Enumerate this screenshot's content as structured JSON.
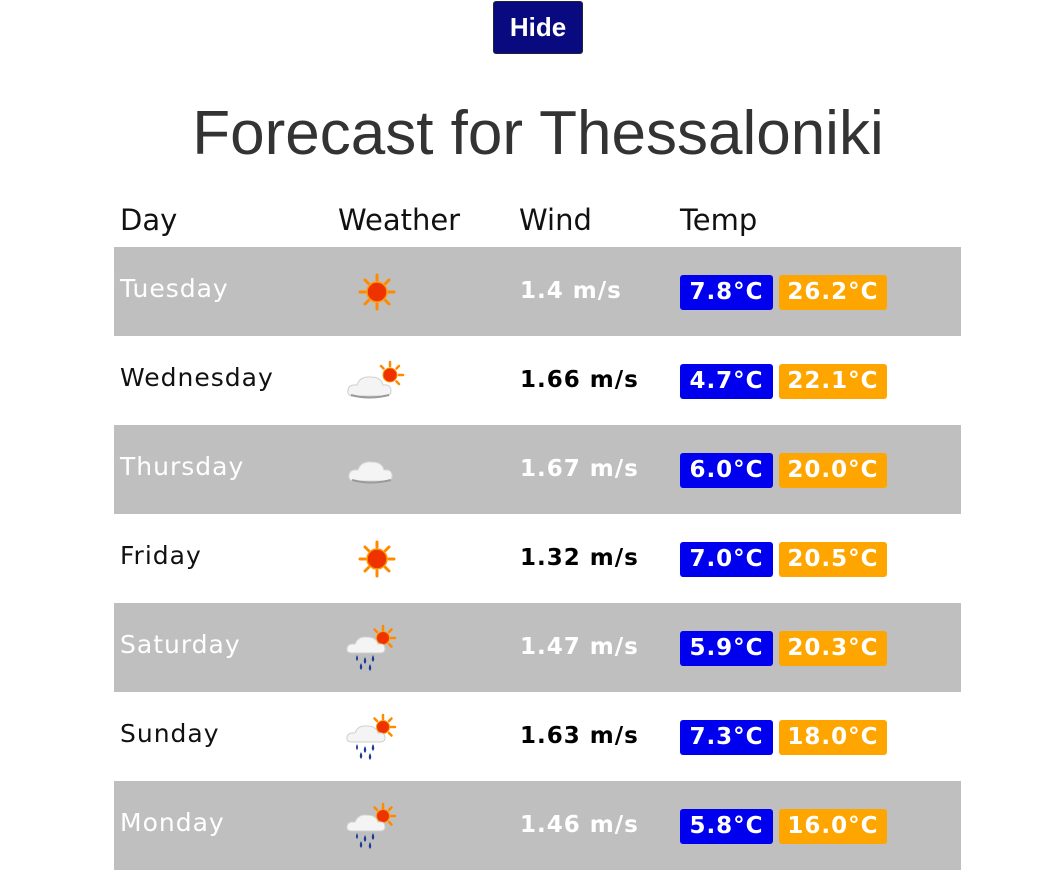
{
  "toolbar": {
    "hide_label": "Hide"
  },
  "page": {
    "title": "Forecast for Thessaloniki"
  },
  "table": {
    "headers": [
      "Day",
      "Weather",
      "Wind",
      "Temp"
    ],
    "rows": [
      {
        "day": "Tuesday",
        "icon": "sunny-icon",
        "wind": "1.4 m/s",
        "min": "7.8°C",
        "max": "26.2°C"
      },
      {
        "day": "Wednesday",
        "icon": "partly-cloudy-icon",
        "wind": "1.66 m/s",
        "min": "4.7°C",
        "max": "22.1°C"
      },
      {
        "day": "Thursday",
        "icon": "cloudy-icon",
        "wind": "1.67 m/s",
        "min": "6.0°C",
        "max": "20.0°C"
      },
      {
        "day": "Friday",
        "icon": "sunny-icon",
        "wind": "1.32 m/s",
        "min": "7.0°C",
        "max": "20.5°C"
      },
      {
        "day": "Saturday",
        "icon": "rain-sun-cloud-icon",
        "wind": "1.47 m/s",
        "min": "5.9°C",
        "max": "20.3°C"
      },
      {
        "day": "Sunday",
        "icon": "rain-sun-cloud-icon",
        "wind": "1.63 m/s",
        "min": "7.3°C",
        "max": "18.0°C"
      },
      {
        "day": "Monday",
        "icon": "rain-sun-cloud-icon",
        "wind": "1.46 m/s",
        "min": "5.8°C",
        "max": "16.0°C"
      }
    ]
  },
  "colors": {
    "button_bg": "#0a0a80",
    "row_shade": "#bfbfbf",
    "min_temp_badge": "#0000ee",
    "max_temp_badge": "#ffa500"
  }
}
